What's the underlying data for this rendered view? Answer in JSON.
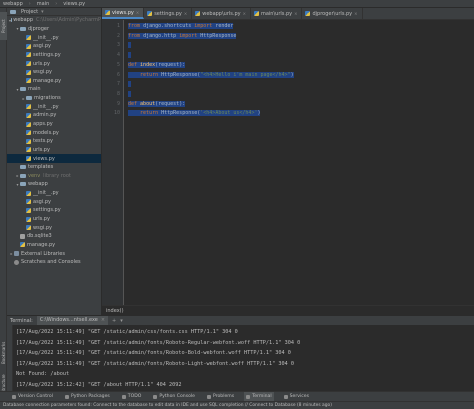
{
  "titlebar": {
    "breadcrumb": [
      "webapp",
      "main",
      "views.py"
    ]
  },
  "tabs": [
    {
      "label": "views.py",
      "active": true
    },
    {
      "label": "settings.py",
      "active": false
    },
    {
      "label": "webapp\\urls.py",
      "active": false
    },
    {
      "label": "main\\urls.py",
      "active": false
    },
    {
      "label": "djproger\\urls.py",
      "active": false
    }
  ],
  "sidebar_stripe": {
    "project_label": "Project",
    "structure_label": "Structure",
    "bookmarks_label": "Bookmarks"
  },
  "project_panel": {
    "header": "Project",
    "tree": [
      {
        "indent": 0,
        "arrow": "▾",
        "icon": "folder",
        "label": "webapp",
        "note": "C:\\Users\\Admin\\PycharmP"
      },
      {
        "indent": 1,
        "arrow": "▾",
        "icon": "folder",
        "label": "djproger",
        "note": ""
      },
      {
        "indent": 2,
        "arrow": "",
        "icon": "py",
        "label": "__init__.py",
        "note": ""
      },
      {
        "indent": 2,
        "arrow": "",
        "icon": "py",
        "label": "asgi.py",
        "note": ""
      },
      {
        "indent": 2,
        "arrow": "",
        "icon": "py",
        "label": "settings.py",
        "note": ""
      },
      {
        "indent": 2,
        "arrow": "",
        "icon": "py",
        "label": "urls.py",
        "note": ""
      },
      {
        "indent": 2,
        "arrow": "",
        "icon": "py",
        "label": "wsgi.py",
        "note": ""
      },
      {
        "indent": 2,
        "arrow": "",
        "icon": "py",
        "label": "manage.py",
        "note": ""
      },
      {
        "indent": 1,
        "arrow": "▾",
        "icon": "folder",
        "label": "main",
        "note": ""
      },
      {
        "indent": 2,
        "arrow": "▸",
        "icon": "folder",
        "label": "migrations",
        "note": ""
      },
      {
        "indent": 2,
        "arrow": "",
        "icon": "py",
        "label": "__init__.py",
        "note": ""
      },
      {
        "indent": 2,
        "arrow": "",
        "icon": "py",
        "label": "admin.py",
        "note": ""
      },
      {
        "indent": 2,
        "arrow": "",
        "icon": "py",
        "label": "apps.py",
        "note": ""
      },
      {
        "indent": 2,
        "arrow": "",
        "icon": "py",
        "label": "models.py",
        "note": ""
      },
      {
        "indent": 2,
        "arrow": "",
        "icon": "py",
        "label": "tests.py",
        "note": ""
      },
      {
        "indent": 2,
        "arrow": "",
        "icon": "py",
        "label": "urls.py",
        "note": ""
      },
      {
        "indent": 2,
        "arrow": "",
        "icon": "py",
        "label": "views.py",
        "note": "",
        "selected": true
      },
      {
        "indent": 1,
        "arrow": "",
        "icon": "folder",
        "label": "templates",
        "note": ""
      },
      {
        "indent": 1,
        "arrow": "▸",
        "icon": "folder",
        "label": "venv",
        "note": "library root"
      },
      {
        "indent": 1,
        "arrow": "▾",
        "icon": "folder",
        "label": "webapp",
        "note": ""
      },
      {
        "indent": 2,
        "arrow": "",
        "icon": "py",
        "label": "__init__.py",
        "note": ""
      },
      {
        "indent": 2,
        "arrow": "",
        "icon": "py",
        "label": "asgi.py",
        "note": ""
      },
      {
        "indent": 2,
        "arrow": "",
        "icon": "py",
        "label": "settings.py",
        "note": ""
      },
      {
        "indent": 2,
        "arrow": "",
        "icon": "py",
        "label": "urls.py",
        "note": ""
      },
      {
        "indent": 2,
        "arrow": "",
        "icon": "py",
        "label": "wsgi.py",
        "note": ""
      },
      {
        "indent": 1,
        "arrow": "",
        "icon": "db",
        "label": "db.sqlite3",
        "note": ""
      },
      {
        "indent": 1,
        "arrow": "",
        "icon": "py",
        "label": "manage.py",
        "note": ""
      },
      {
        "indent": 0,
        "arrow": "▸",
        "icon": "lib",
        "label": "External Libraries",
        "note": ""
      },
      {
        "indent": 0,
        "arrow": "",
        "icon": "scratch",
        "label": "Scratches and Consoles",
        "note": ""
      }
    ]
  },
  "editor": {
    "line_numbers": [
      "1",
      "2",
      "3",
      "4",
      "5",
      "6",
      "7",
      "8",
      "9",
      "10"
    ],
    "code_lines": [
      [
        {
          "t": "from ",
          "c": "kw"
        },
        {
          "t": "django.shortcuts ",
          "c": "plain"
        },
        {
          "t": "import ",
          "c": "kw"
        },
        {
          "t": "render",
          "c": "plain"
        }
      ],
      [
        {
          "t": "from ",
          "c": "kw"
        },
        {
          "t": "django.http ",
          "c": "plain"
        },
        {
          "t": "import ",
          "c": "kw"
        },
        {
          "t": "HttpResponse",
          "c": "plain"
        }
      ],
      [],
      [],
      [
        {
          "t": "def ",
          "c": "kw"
        },
        {
          "t": "index",
          "c": "fn"
        },
        {
          "t": "(request):",
          "c": "plain"
        }
      ],
      [
        {
          "t": "    return ",
          "c": "kw"
        },
        {
          "t": "HttpResponse(",
          "c": "plain"
        },
        {
          "t": "\"<h4>Hello i'm main page</h4>\"",
          "c": "str"
        },
        {
          "t": ")",
          "c": "plain"
        }
      ],
      [],
      [],
      [
        {
          "t": "def ",
          "c": "kw"
        },
        {
          "t": "about",
          "c": "fn"
        },
        {
          "t": "(request):",
          "c": "plain"
        }
      ],
      [
        {
          "t": "    return ",
          "c": "kw"
        },
        {
          "t": "HttpResponse(",
          "c": "plain"
        },
        {
          "t": "'<h4>About us</h4>'",
          "c": "str"
        },
        {
          "t": ")",
          "c": "plain"
        }
      ]
    ],
    "breadcrumb": "index()"
  },
  "terminal": {
    "label": "Terminal:",
    "tabs": [
      {
        "label": "C:\\Windows...ntsell.exe",
        "active": true
      }
    ],
    "lines": [
      "[17/Aug/2022 15:11:49] \"GET /static/admin/css/fonts.css HTTP/1.1\" 304 0",
      "[17/Aug/2022 15:11:49] \"GET /static/admin/fonts/Roboto-Regular-webfont.woff HTTP/1.1\" 304 0",
      "[17/Aug/2022 15:11:49] \"GET /static/admin/fonts/Roboto-Bold-webfont.woff HTTP/1.1\" 304 0",
      "[17/Aug/2022 15:11:49] \"GET /static/admin/fonts/Roboto-Light-webfont.woff HTTP/1.1\" 304 0",
      "Not Found: /about",
      "[17/Aug/2022 15:12:42] \"GET /about HTTP/1.1\" 404 2092"
    ]
  },
  "bottom_tools": [
    {
      "label": "Version Control",
      "icon": "branch-icon",
      "active": false
    },
    {
      "label": "Python Packages",
      "icon": "package-icon",
      "active": false
    },
    {
      "label": "TODO",
      "icon": "list-icon",
      "active": false
    },
    {
      "label": "Python Console",
      "icon": "python-icon",
      "active": false
    },
    {
      "label": "Problems",
      "icon": "warning-icon",
      "active": false
    },
    {
      "label": "Terminal",
      "icon": "terminal-icon",
      "active": true
    },
    {
      "label": "Services",
      "icon": "services-icon",
      "active": false
    }
  ],
  "statusbar": {
    "text": "Database connection parameters found: Connect to the database to edit data in IDE and use SQL completion // Connect to Database (8 minutes ago)"
  },
  "colors": {
    "selection": "#214283",
    "keyword": "#cc7832",
    "string": "#6a8759",
    "function": "#ffc66d",
    "accent": "#4a88c7"
  }
}
